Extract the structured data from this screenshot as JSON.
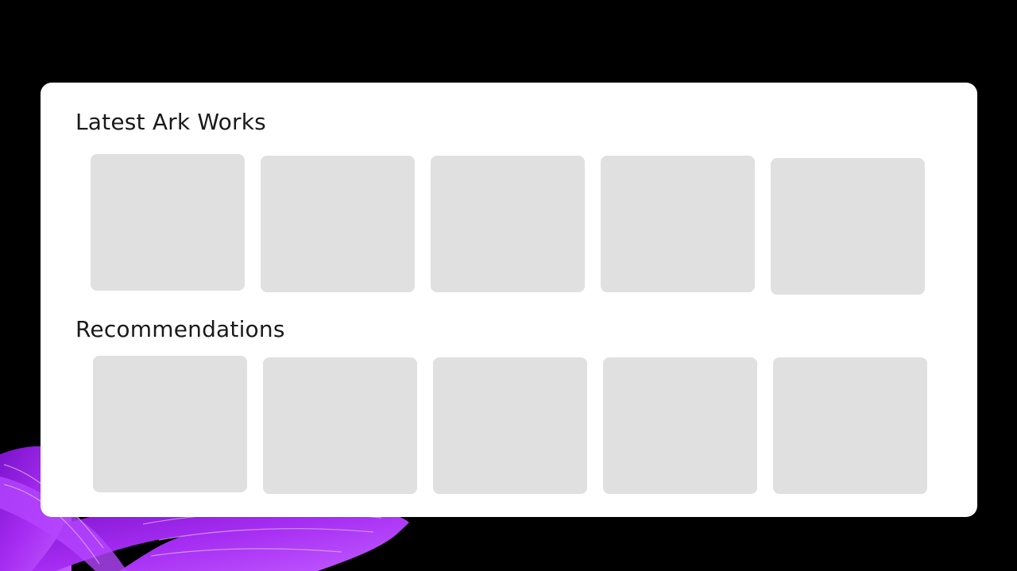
{
  "sections": [
    {
      "title": "Latest Ark Works",
      "tiles": [
        "",
        "",
        "",
        "",
        ""
      ]
    },
    {
      "title": "Recommendations",
      "tiles": [
        "",
        "",
        "",
        "",
        ""
      ]
    }
  ],
  "colors": {
    "background": "#000000",
    "card": "#ffffff",
    "tile": "#e0e0e0",
    "brush_accent": "#9b1fe8",
    "title_text": "#1a1a1a"
  }
}
